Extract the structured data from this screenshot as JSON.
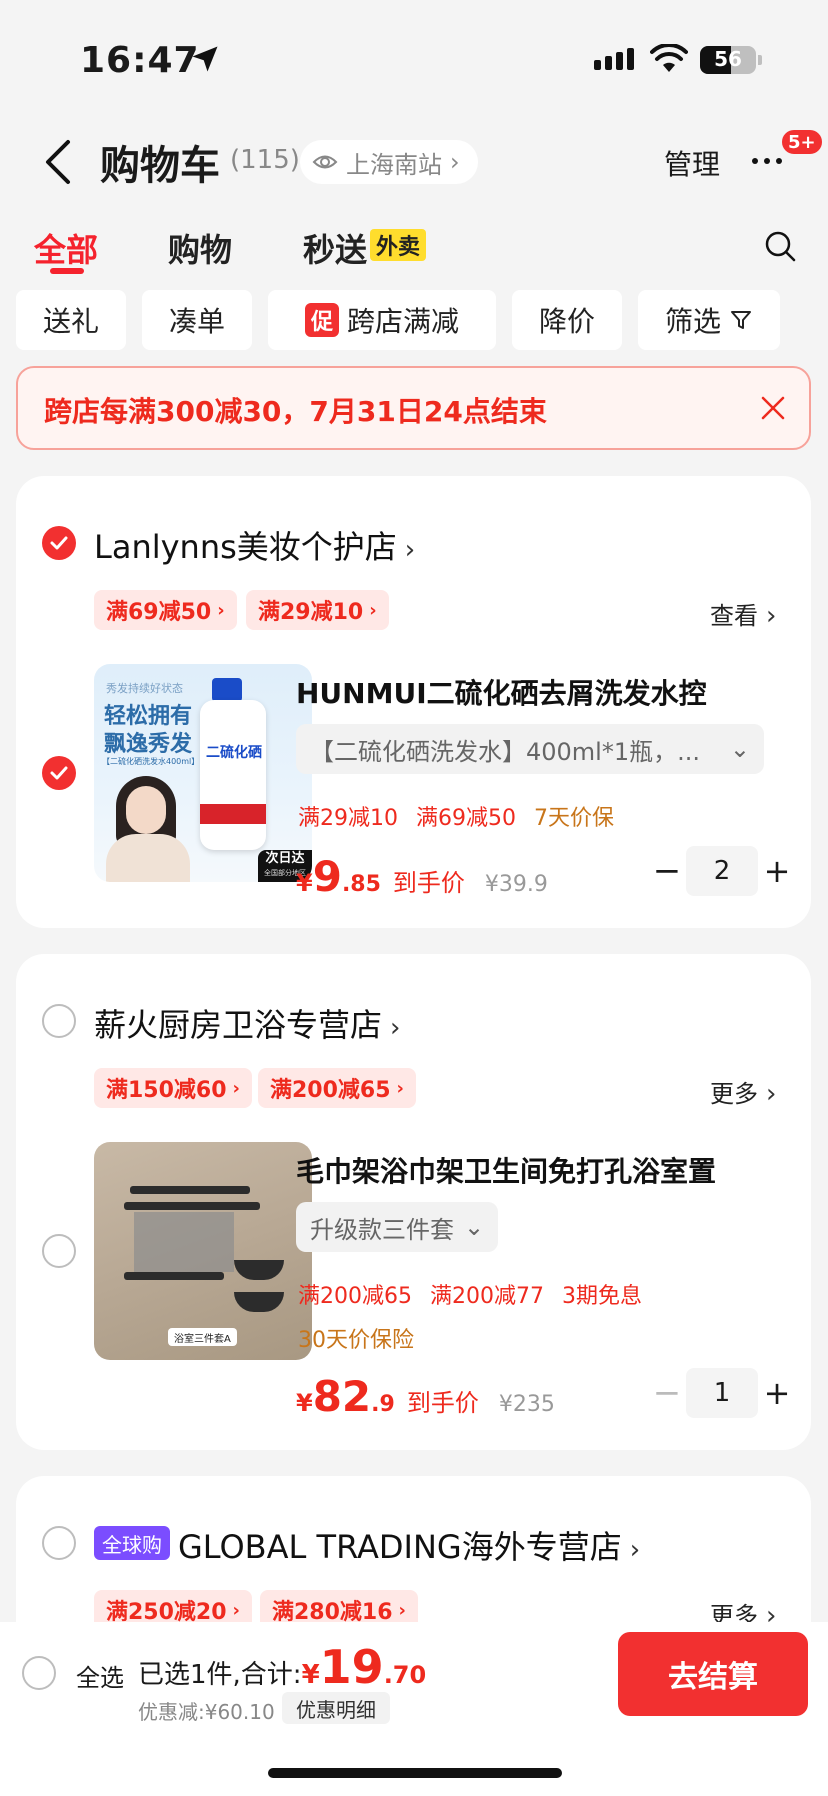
{
  "status_bar": {
    "time": "16:47",
    "battery": "56"
  },
  "header": {
    "title": "购物车",
    "count": "(115)",
    "location": "上海南站",
    "manage": "管理",
    "badge": "5+"
  },
  "tabs": [
    {
      "label": "全部"
    },
    {
      "label": "购物"
    },
    {
      "label": "秒送"
    }
  ],
  "waimai_badge": "外卖",
  "filters": {
    "gift": "送礼",
    "combine": "凑单",
    "promo_tag": "促",
    "cross_store": "跨店满减",
    "price_drop": "降价",
    "filter": "筛选"
  },
  "banner": {
    "text": "跨店每满300减30，7月31日24点结束"
  },
  "stores": [
    {
      "name": "Lanlynns美妆个护店",
      "checked": true,
      "coupons": [
        "满69减50",
        "满29减10"
      ],
      "link": "查看",
      "product": {
        "title": "HUNMUI二硫化硒去屑洗发水控",
        "spec": "【二硫化硒洗发水】400ml*1瓶，...",
        "promos": [
          "满29减10",
          "满69减50",
          "7天价保"
        ],
        "price_int": "9",
        "price_dec": ".85",
        "price_label": "到手价",
        "original_price": "¥39.9",
        "quantity": "2",
        "image_text": {
          "top": "秀发持续好状态",
          "line1": "轻松拥有",
          "line2": "飘逸秀发",
          "sub": "【二硫化硒洗发水400ml】",
          "bottle": "二硫化硒",
          "tag1": "次日达",
          "tag2": "全国部分地区"
        }
      }
    },
    {
      "name": "薪火厨房卫浴专营店",
      "checked": false,
      "coupons": [
        "满150减60",
        "满200减65"
      ],
      "link": "更多",
      "product": {
        "title": "毛巾架浴巾架卫生间免打孔浴室置",
        "spec": "升级款三件套",
        "promos": [
          "满200减65",
          "满200减77",
          "3期免息"
        ],
        "promo_line2": "30天价保险",
        "price_int": "82",
        "price_dec": ".9",
        "price_label": "到手价",
        "original_price": "¥235",
        "quantity": "1",
        "image_text": {
          "caption": "浴室三件套A"
        }
      }
    },
    {
      "name": "GLOBAL TRADING海外专营店",
      "tag": "全球购",
      "checked": false,
      "coupons": [
        "满250减20",
        "满280减16"
      ],
      "link": "更多"
    }
  ],
  "bottom": {
    "select_all": "全选",
    "selected": "已选1件,合计:",
    "currency": "¥",
    "total_int": "19",
    "total_dec": ".70",
    "discount": "优惠减:¥60.10",
    "detail": "优惠明细",
    "checkout": "去结算"
  },
  "colors": {
    "accent": "#f23030",
    "promo_orange": "#c8751a",
    "global_purple": "#7b4dff"
  }
}
